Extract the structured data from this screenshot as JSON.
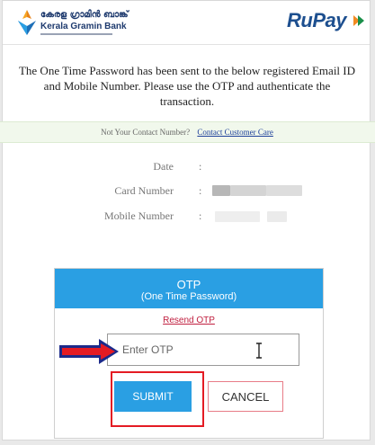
{
  "header": {
    "bank_name_ml": "കേരള ഗ്രാമിൻ ബാങ്ക്",
    "bank_name_en": "Kerala Gramin Bank",
    "card_network": "RuPay",
    "colors": {
      "bank_blue": "#1e3a6e",
      "rupay_blue": "#1d4f8f",
      "rupay_orange": "#f18a21"
    }
  },
  "message": "The One Time Password has been sent to the below registered Email ID and Mobile Number. Please use the OTP and authenticate the transaction.",
  "contact_band": {
    "prompt": "Not Your Contact Number?",
    "link": "Contact Customer Care"
  },
  "details": [
    {
      "label": "Date",
      "colon": ":"
    },
    {
      "label": "Card Number",
      "colon": ":"
    },
    {
      "label": "Mobile Number",
      "colon": ":"
    }
  ],
  "otp_panel": {
    "title": "OTP",
    "subtitle": "(One Time Password)",
    "resend_label": "Resend OTP",
    "input_placeholder": "Enter OTP",
    "submit_label": "SUBMIT",
    "cancel_label": "CANCEL",
    "colors": {
      "accent": "#2a9fe3",
      "link_red": "#c02040",
      "annotation_red": "#e41b23"
    }
  }
}
